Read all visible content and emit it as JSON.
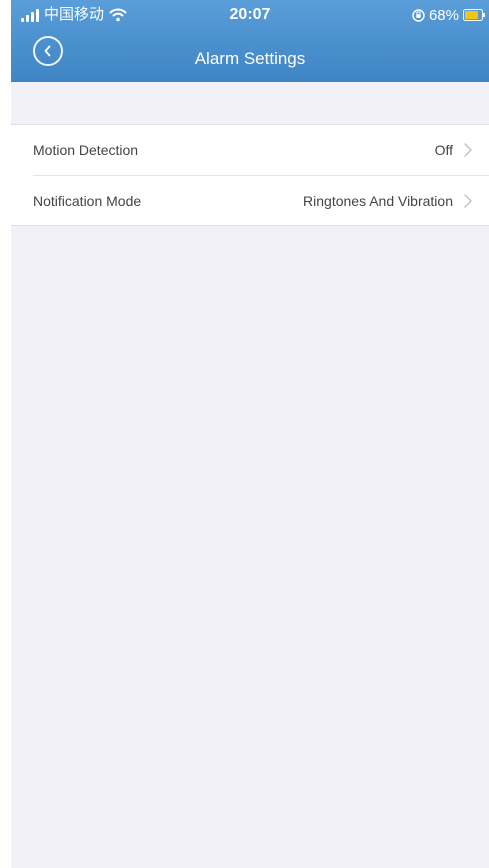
{
  "status_bar": {
    "carrier": "中国移动",
    "time": "20:07",
    "battery": "68%",
    "icons": [
      "signal-icon",
      "wifi-icon",
      "orientation-lock-icon",
      "battery-icon"
    ]
  },
  "nav": {
    "title": "Alarm Settings",
    "back_icon": "chevron-left-icon"
  },
  "settings": {
    "items": [
      {
        "label": "Motion Detection",
        "value": "Off",
        "icon": "chevron-right-icon"
      },
      {
        "label": "Notification Mode",
        "value": "Ringtones And Vibration",
        "icon": "chevron-right-icon"
      }
    ]
  },
  "colors": {
    "header": "#4d92d0",
    "background": "#f1f1f7",
    "row_background": "#ffffff",
    "text": "#444444",
    "chevron": "#c4c4c8",
    "battery": "#f0c419"
  }
}
